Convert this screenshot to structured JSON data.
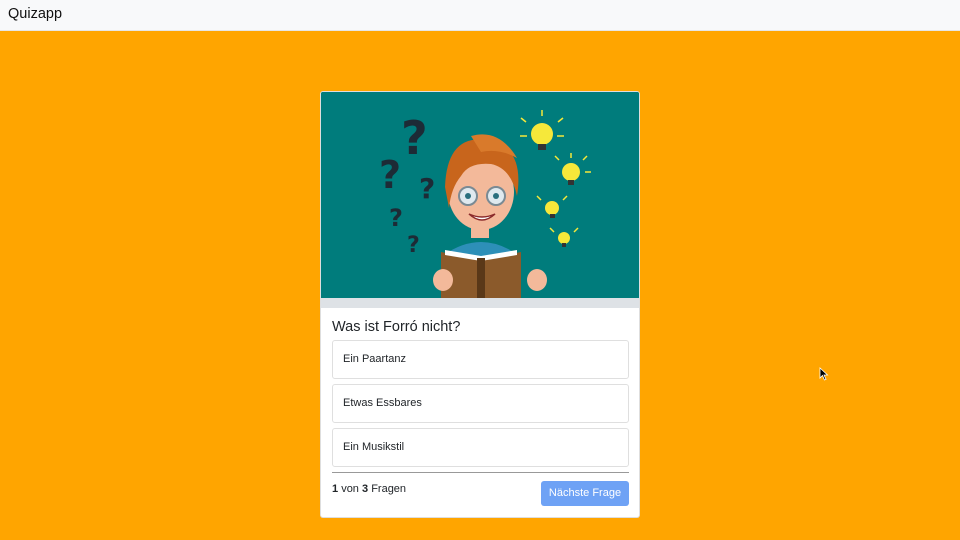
{
  "app": {
    "title": "Quizapp"
  },
  "quiz": {
    "image_description_icon": "teacher-reading-book-illustration",
    "question": "Was ist Forró nicht?",
    "answers": [
      {
        "label": "Ein Paartanz"
      },
      {
        "label": "Etwas Essbares"
      },
      {
        "label": "Ein Musikstil"
      }
    ],
    "progress": {
      "current": "1",
      "connector": "von",
      "total": "3",
      "suffix": "Fragen"
    },
    "next_button_label": "Nächste Frage"
  },
  "colors": {
    "page_background": "#FFA500",
    "image_background": "#007C7C",
    "next_button": "#6ea2f5"
  }
}
